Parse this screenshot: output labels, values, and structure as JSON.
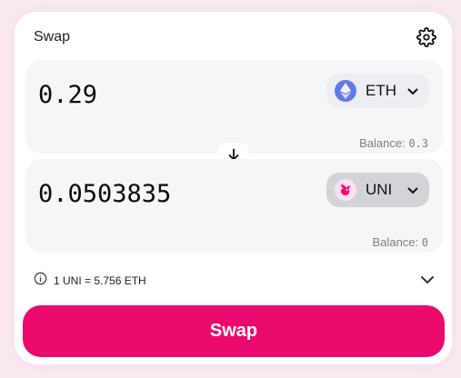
{
  "header": {
    "title": "Swap",
    "settings_icon": "gear-icon"
  },
  "input_panel": {
    "amount": "0.29",
    "token": {
      "symbol": "ETH",
      "icon": "ethereum-icon",
      "color": "#6279e8"
    },
    "balance_label": "Balance:",
    "balance_value": "0.3"
  },
  "output_panel": {
    "amount": "0.0503835",
    "token": {
      "symbol": "UNI",
      "icon": "uniswap-icon",
      "color": "#ff007a"
    },
    "balance_label": "Balance:",
    "balance_value": "0"
  },
  "switch_icon": "arrow-down-icon",
  "rate": {
    "text": "1 UNI = 5.756 ETH",
    "info_icon": "info-icon",
    "expand_icon": "chevron-down-icon"
  },
  "swap_button_label": "Swap",
  "colors": {
    "accent": "#ea0a6e",
    "panel": "#f5f6f8",
    "background": "#f8e9f1"
  }
}
